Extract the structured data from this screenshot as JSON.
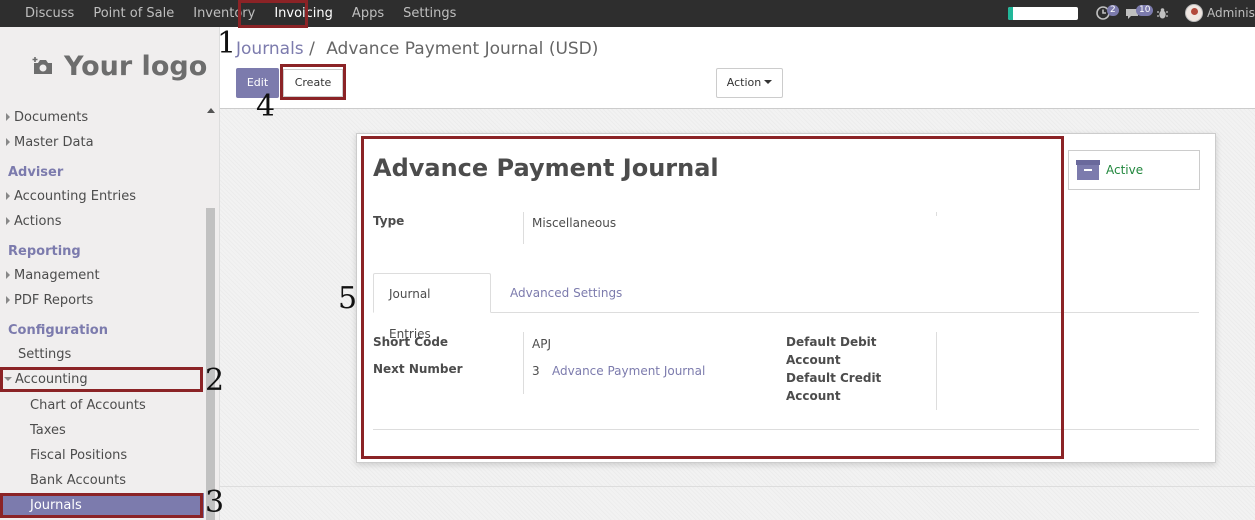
{
  "topbar": {
    "menu": [
      "Discuss",
      "Point of Sale",
      "Inventory",
      "Invoicing",
      "Apps",
      "Settings"
    ],
    "active_menu": "Invoicing",
    "progress_fraction": 0.07,
    "activity_count": "2",
    "messages_count": "10",
    "user": "Adminis"
  },
  "sidebar": {
    "logo_text": "Your logo",
    "items_top": [
      {
        "label": "Documents"
      },
      {
        "label": "Master Data"
      }
    ],
    "section_adviser": "Adviser",
    "items_adviser": [
      {
        "label": "Accounting Entries"
      },
      {
        "label": "Actions"
      }
    ],
    "section_reporting": "Reporting",
    "items_reporting": [
      {
        "label": "Management"
      },
      {
        "label": "PDF Reports"
      }
    ],
    "section_configuration": "Configuration",
    "settings": "Settings",
    "accounting": "Accounting",
    "sub_items": [
      {
        "label": "Chart of Accounts"
      },
      {
        "label": "Taxes"
      },
      {
        "label": "Fiscal Positions"
      },
      {
        "label": "Bank Accounts"
      },
      {
        "label": "Journals"
      }
    ]
  },
  "control_panel": {
    "breadcrumb_link": "Journals",
    "breadcrumb_sep": "/",
    "breadcrumb_current": "Advance Payment Journal (USD)",
    "edit": "Edit",
    "create": "Create",
    "action": "Action"
  },
  "form": {
    "title": "Advance Payment Journal",
    "type_label": "Type",
    "type_value": "Miscellaneous",
    "tabs": [
      "Journal Entries",
      "Advanced Settings"
    ],
    "short_code_label": "Short Code",
    "short_code_value": "APJ",
    "next_number_label": "Next Number",
    "next_number_value": "3",
    "next_number_link": "Advance Payment Journal",
    "default_debit_label_1": "Default Debit",
    "default_debit_label_2": "Account",
    "default_credit_label_1": "Default Credit",
    "default_credit_label_2": "Account",
    "status": "Active"
  },
  "annotations": [
    "1",
    "2",
    "3",
    "4",
    "5"
  ],
  "colors": {
    "accent": "#7c7bad",
    "highlight": "#8b2326",
    "topbar": "#2e2e2e",
    "active_green": "#21873d"
  }
}
